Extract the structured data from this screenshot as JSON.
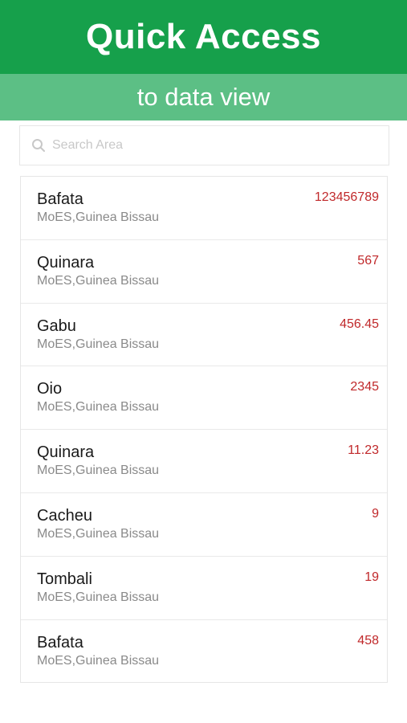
{
  "header": {
    "title": "Quick Access",
    "subtitle": "to data view"
  },
  "search": {
    "placeholder": "Search Area",
    "icon": "search-icon"
  },
  "colors": {
    "header_bg": "#16a04b",
    "subheader_bg": "#5cbf85",
    "value_color": "#c0282a"
  },
  "items": [
    {
      "name": "Bafata",
      "subtitle": "MoES,Guinea Bissau",
      "value": "123456789"
    },
    {
      "name": "Quinara",
      "subtitle": "MoES,Guinea Bissau",
      "value": "567"
    },
    {
      "name": "Gabu",
      "subtitle": "MoES,Guinea Bissau",
      "value": "456.45"
    },
    {
      "name": "Oio",
      "subtitle": "MoES,Guinea Bissau",
      "value": "2345"
    },
    {
      "name": "Quinara",
      "subtitle": "MoES,Guinea Bissau",
      "value": "11.23"
    },
    {
      "name": "Cacheu",
      "subtitle": "MoES,Guinea Bissau",
      "value": "9"
    },
    {
      "name": "Tombali",
      "subtitle": "MoES,Guinea Bissau",
      "value": "19"
    },
    {
      "name": "Bafata",
      "subtitle": "MoES,Guinea Bissau",
      "value": "458"
    }
  ]
}
